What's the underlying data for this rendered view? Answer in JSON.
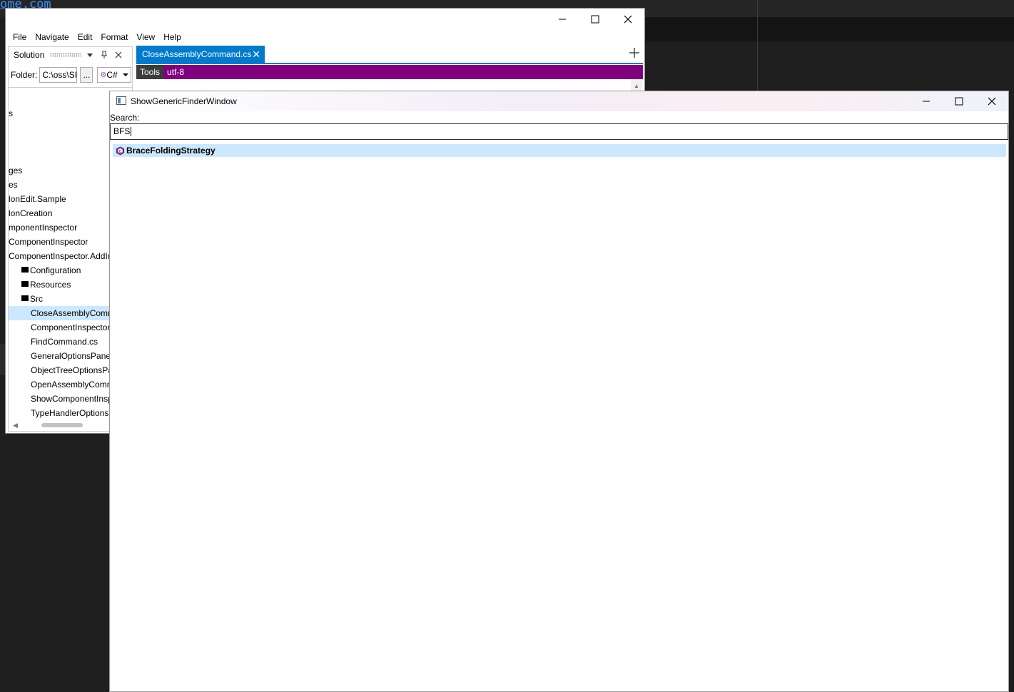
{
  "background": {
    "link_text": "ome.com"
  },
  "main_window": {
    "menu": [
      "File",
      "Navigate",
      "Edit",
      "Format",
      "View",
      "Help"
    ],
    "solution_pane": {
      "title": "Solution",
      "folder_label": "Folder:",
      "folder_value": "C:\\oss\\SI",
      "browse_label": "...",
      "language": "C#",
      "tree": [
        {
          "label": "s",
          "indent": 0,
          "folder": false,
          "selected": false
        },
        {
          "label": "ges",
          "indent": 0,
          "folder": false,
          "selected": false
        },
        {
          "label": "es",
          "indent": 0,
          "folder": false,
          "selected": false
        },
        {
          "label": "lonEdit.Sample",
          "indent": 0,
          "folder": false,
          "selected": false
        },
        {
          "label": "lonCreation",
          "indent": 0,
          "folder": false,
          "selected": false
        },
        {
          "label": "mponentInspector",
          "indent": 0,
          "folder": false,
          "selected": false
        },
        {
          "label": "ComponentInspector",
          "indent": 0,
          "folder": false,
          "selected": false
        },
        {
          "label": "ComponentInspector.AddIn",
          "indent": 0,
          "folder": false,
          "selected": false
        },
        {
          "label": "Configuration",
          "indent": 1,
          "folder": true,
          "selected": false
        },
        {
          "label": "Resources",
          "indent": 1,
          "folder": true,
          "selected": false
        },
        {
          "label": "Src",
          "indent": 1,
          "folder": true,
          "selected": false
        },
        {
          "label": "CloseAssemblyCommand.cs",
          "indent": 2,
          "folder": false,
          "selected": true
        },
        {
          "label": "ComponentInspectorC",
          "indent": 2,
          "folder": false,
          "selected": false
        },
        {
          "label": "FindCommand.cs",
          "indent": 2,
          "folder": false,
          "selected": false
        },
        {
          "label": "GeneralOptionsPanel",
          "indent": 2,
          "folder": false,
          "selected": false
        },
        {
          "label": "ObjectTreeOptionsPa",
          "indent": 2,
          "folder": false,
          "selected": false
        },
        {
          "label": "OpenAssemblyComm",
          "indent": 2,
          "folder": false,
          "selected": false
        },
        {
          "label": "ShowComponentInsp",
          "indent": 2,
          "folder": false,
          "selected": false
        },
        {
          "label": "TypeHandlerOptionsP",
          "indent": 2,
          "folder": false,
          "selected": false
        }
      ]
    },
    "editor": {
      "tab_label": "CloseAssemblyCommand.cs",
      "tools_label": "Tools",
      "encoding": "utf-8"
    }
  },
  "finder": {
    "title": "ShowGenericFinderWindow",
    "search_label": "Search:",
    "search_value": "BFS",
    "results": [
      {
        "label": "BraceFoldingStrategy",
        "icon": "class-icon",
        "selected": true
      }
    ]
  },
  "colors": {
    "accent": "#007acc",
    "tools_bar": "#800080",
    "selection": "#cce8ff",
    "class_icon": "#68217a"
  }
}
